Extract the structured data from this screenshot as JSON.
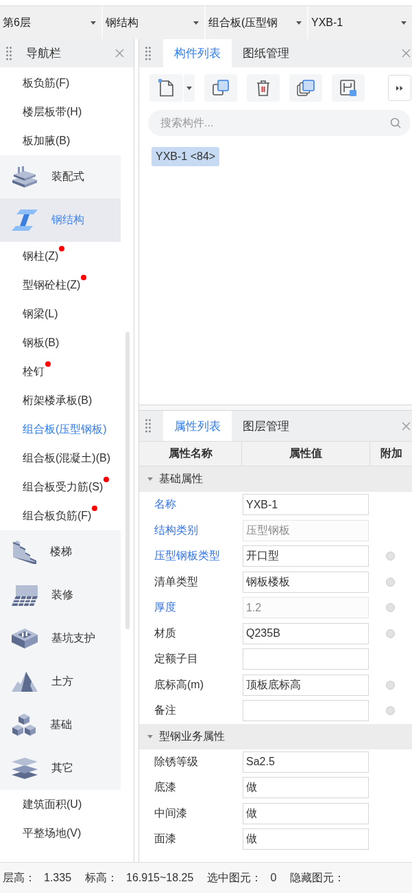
{
  "toolbar_selectors": [
    {
      "value": "第6层"
    },
    {
      "value": "钢结构"
    },
    {
      "value": "组合板(压型钢"
    },
    {
      "value": "YXB-1"
    }
  ],
  "nav_panel": {
    "title": "导航栏",
    "items": [
      {
        "kind": "item",
        "label": "板负筋(F)",
        "selected": false,
        "dot": false
      },
      {
        "kind": "item",
        "label": "楼层板带(H)",
        "selected": false,
        "dot": false
      },
      {
        "kind": "item",
        "label": "板加腋(B)",
        "selected": false,
        "dot": false
      },
      {
        "kind": "group",
        "label": "装配式",
        "selected": false,
        "dot": false
      },
      {
        "kind": "group",
        "label": "钢结构",
        "selected": true,
        "dot": false
      },
      {
        "kind": "item",
        "label": "钢柱(Z)",
        "selected": false,
        "dot": true
      },
      {
        "kind": "item",
        "label": "型钢砼柱(Z)",
        "selected": false,
        "dot": true
      },
      {
        "kind": "item",
        "label": "钢梁(L)",
        "selected": false,
        "dot": false
      },
      {
        "kind": "item",
        "label": "钢板(B)",
        "selected": false,
        "dot": false
      },
      {
        "kind": "item",
        "label": "栓钉",
        "selected": false,
        "dot": true
      },
      {
        "kind": "item",
        "label": "桁架楼承板(B)",
        "selected": false,
        "dot": false
      },
      {
        "kind": "item",
        "label": "组合板(压型钢板)",
        "selected": true,
        "dot": false
      },
      {
        "kind": "item",
        "label": "组合板(混凝土)(B)",
        "selected": false,
        "dot": false
      },
      {
        "kind": "item",
        "label": "组合板受力筋(S)",
        "selected": false,
        "dot": true
      },
      {
        "kind": "item",
        "label": "组合板负筋(F)",
        "selected": false,
        "dot": true
      },
      {
        "kind": "group",
        "label": "楼梯",
        "selected": false,
        "dot": false
      },
      {
        "kind": "group",
        "label": "装修",
        "selected": false,
        "dot": false
      },
      {
        "kind": "group",
        "label": "基坑支护",
        "selected": false,
        "dot": false
      },
      {
        "kind": "group",
        "label": "土方",
        "selected": false,
        "dot": false
      },
      {
        "kind": "group",
        "label": "基础",
        "selected": false,
        "dot": false
      },
      {
        "kind": "group",
        "label": "其它",
        "selected": false,
        "dot": false
      },
      {
        "kind": "item",
        "label": "建筑面积(U)",
        "selected": false,
        "dot": false
      },
      {
        "kind": "item",
        "label": "平整场地(V)",
        "selected": false,
        "dot": false
      }
    ]
  },
  "component_panel": {
    "tabs": [
      {
        "label": "构件列表",
        "selected": true
      },
      {
        "label": "图纸管理",
        "selected": false
      }
    ],
    "search": {
      "placeholder": "搜索构件..."
    },
    "components": [
      {
        "label": "YXB-1 <84>",
        "selected": true
      }
    ]
  },
  "property_panel": {
    "tabs": [
      {
        "label": "属性列表",
        "selected": true
      },
      {
        "label": "图层管理",
        "selected": false
      }
    ],
    "columns": [
      "属性名称",
      "属性值",
      "附加"
    ],
    "groups": [
      {
        "title": "基础属性",
        "expanded": true,
        "rows": [
          {
            "name": "名称",
            "value": "YXB-1",
            "public": true,
            "disabled": false,
            "attachable": false
          },
          {
            "name": "结构类别",
            "value": "压型钢板",
            "public": true,
            "disabled": true,
            "attachable": false
          },
          {
            "name": "压型钢板类型",
            "value": "开口型",
            "public": true,
            "disabled": false,
            "attachable": true
          },
          {
            "name": "清单类型",
            "value": "钢板楼板",
            "public": false,
            "disabled": false,
            "attachable": true
          },
          {
            "name": "厚度",
            "value": "1.2",
            "public": true,
            "disabled": true,
            "attachable": true
          },
          {
            "name": "材质",
            "value": "Q235B",
            "public": false,
            "disabled": false,
            "attachable": true
          },
          {
            "name": "定额子目",
            "public": false,
            "disabled": false,
            "attachable": false
          },
          {
            "name": "底标高(m)",
            "value": "顶板底标高",
            "public": false,
            "disabled": false,
            "attachable": true
          },
          {
            "name": "备注",
            "public": false,
            "disabled": false,
            "attachable": true
          }
        ]
      },
      {
        "title": "型钢业务属性",
        "expanded": true,
        "rows": [
          {
            "name": "除锈等级",
            "value": "Sa2.5",
            "public": false,
            "disabled": false,
            "attachable": false
          },
          {
            "name": "底漆",
            "value": "做",
            "public": false,
            "disabled": false,
            "attachable": false
          },
          {
            "name": "中间漆",
            "value": "做",
            "public": false,
            "disabled": false,
            "attachable": false
          },
          {
            "name": "面漆",
            "value": "做",
            "public": false,
            "disabled": false,
            "attachable": false
          }
        ]
      }
    ]
  },
  "status_bar": [
    {
      "label": "层高：",
      "value": "1.335"
    },
    {
      "label": "标高：",
      "value": "16.915~18.25"
    },
    {
      "label": "选中图元：",
      "value": "0"
    },
    {
      "label": "隐藏图元："
    }
  ]
}
